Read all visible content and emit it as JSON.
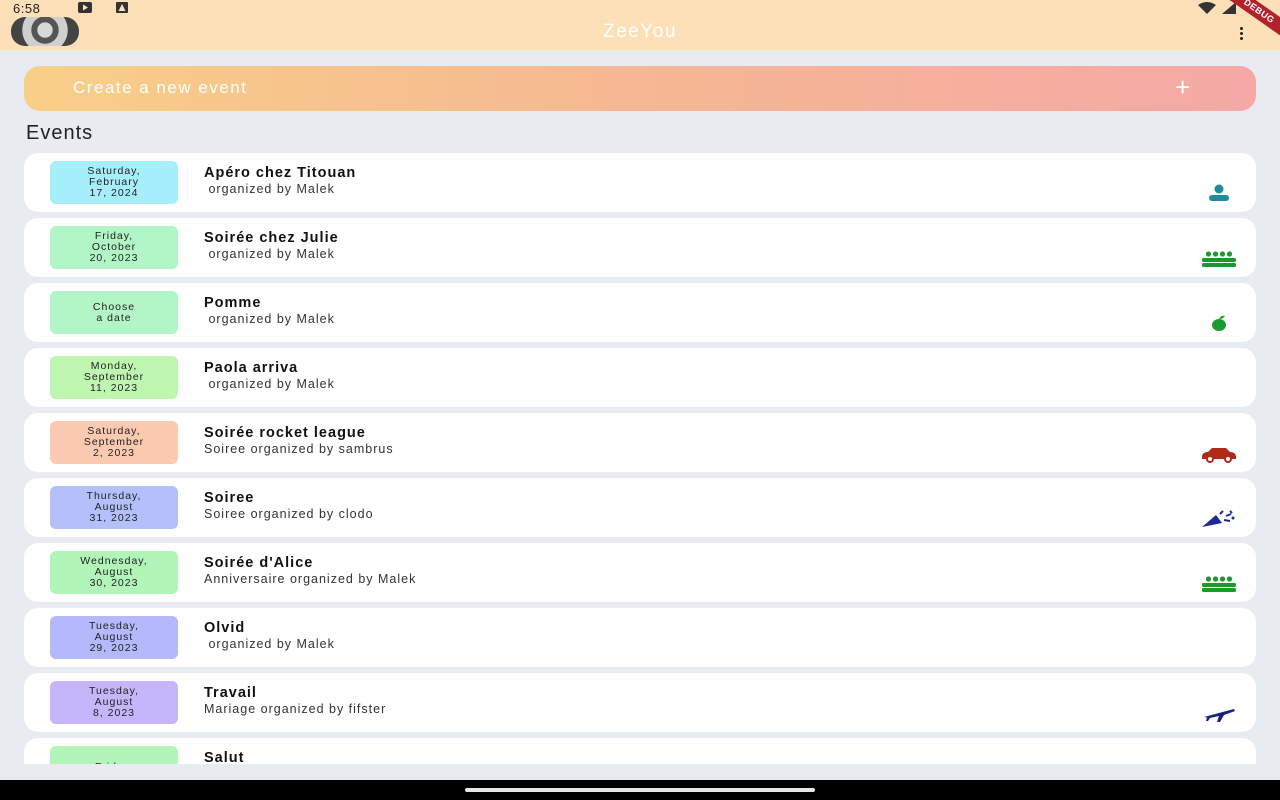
{
  "status_bar": {
    "time": "6:58"
  },
  "app_bar": {
    "title": "ZeeYou",
    "debug_label": "DEBUG"
  },
  "create_event": {
    "label": "Create a new event",
    "plus": "+"
  },
  "events_section": {
    "title": "Events"
  },
  "colors": {
    "app_bar": "#fde0b8",
    "background": "#e8ebf0",
    "gradient_start": "#f8cf88",
    "gradient_end": "#f5a8a6"
  },
  "events": [
    {
      "date": "Saturday,\nFebruary\n17, 2024",
      "title": "Apéro chez Titouan",
      "subtitle": " organized by Malek",
      "badge_color": "#a6eefb",
      "icon": "person-icon",
      "icon_color": "#1f8aa0"
    },
    {
      "date": "Friday,\nOctober\n20, 2023",
      "title": "Soirée chez Julie",
      "subtitle": " organized by Malek",
      "badge_color": "#b2f5c6",
      "icon": "group-icon",
      "icon_color": "#1a9a2e"
    },
    {
      "date": "Choose\na date",
      "title": "Pomme",
      "subtitle": " organized by Malek",
      "badge_color": "#b2f5c6",
      "icon": "apple-icon",
      "icon_color": "#1a9a2e"
    },
    {
      "date": "Monday,\nSeptember\n11, 2023",
      "title": "Paola arriva",
      "subtitle": " organized by Malek",
      "badge_color": "#bff7b0",
      "icon": "",
      "icon_color": ""
    },
    {
      "date": "Saturday,\nSeptember\n2, 2023",
      "title": "Soirée rocket league",
      "subtitle": "Soiree organized by sambrus",
      "badge_color": "#fccab0",
      "icon": "car-icon",
      "icon_color": "#b02a1a"
    },
    {
      "date": "Thursday,\nAugust\n31, 2023",
      "title": "Soiree",
      "subtitle": "Soiree organized by clodo",
      "badge_color": "#b3c0fb",
      "icon": "party-popper-icon",
      "icon_color": "#1a2a9a"
    },
    {
      "date": "Wednesday,\nAugust\n30, 2023",
      "title": "Soirée d'Alice",
      "subtitle": "Anniversaire organized by Malek",
      "badge_color": "#b2f5b8",
      "icon": "group-icon",
      "icon_color": "#1a9a2e"
    },
    {
      "date": "Tuesday,\nAugust\n29, 2023",
      "title": "Olvid",
      "subtitle": " organized by Malek",
      "badge_color": "#b3b9fb",
      "icon": "",
      "icon_color": ""
    },
    {
      "date": "Tuesday,\nAugust\n8, 2023",
      "title": "Travail",
      "subtitle": "Mariage organized by fifster",
      "badge_color": "#c5b6fb",
      "icon": "airplane-icon",
      "icon_color": "#1a1f80"
    },
    {
      "date": "Friday,",
      "title": "Salut",
      "subtitle": "",
      "badge_color": "#b2f5b8",
      "icon": "",
      "icon_color": ""
    }
  ]
}
